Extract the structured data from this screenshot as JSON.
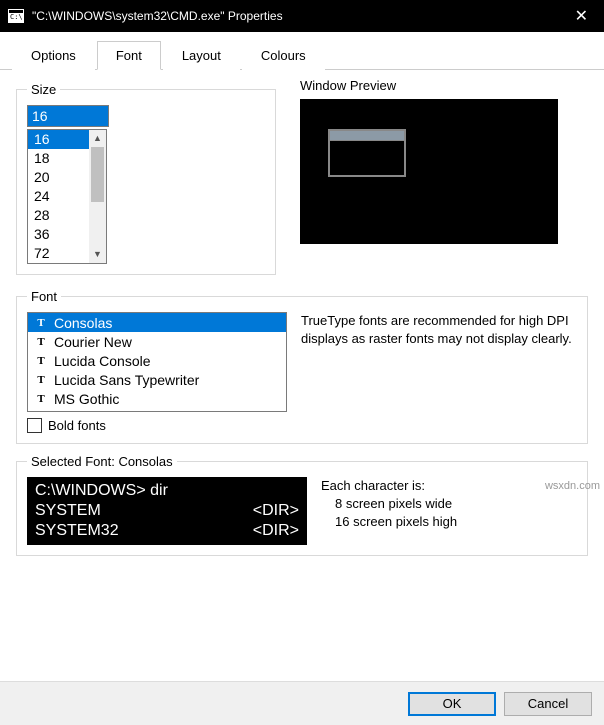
{
  "window": {
    "title": "\"C:\\WINDOWS\\system32\\CMD.exe\" Properties"
  },
  "tabs": {
    "t0": "Options",
    "t1": "Font",
    "t2": "Layout",
    "t3": "Colours"
  },
  "size": {
    "legend": "Size",
    "value": "16",
    "items": {
      "i0": "16",
      "i1": "18",
      "i2": "20",
      "i3": "24",
      "i4": "28",
      "i5": "36",
      "i6": "72"
    }
  },
  "preview": {
    "label": "Window Preview"
  },
  "font": {
    "legend": "Font",
    "items": {
      "i0": "Consolas",
      "i1": "Courier New",
      "i2": "Lucida Console",
      "i3": "Lucida Sans Typewriter",
      "i4": "MS Gothic"
    },
    "hint": "TrueType fonts are recommended for high DPI displays as raster fonts may not display clearly.",
    "bold_label": "Bold fonts"
  },
  "selected": {
    "legend": "Selected Font: Consolas",
    "sample_l1": "C:\\WINDOWS> dir",
    "sample_l2a": "SYSTEM",
    "sample_l2b": "<DIR>",
    "sample_l3a": "SYSTEM32",
    "sample_l3b": "<DIR>",
    "each": "Each character is:",
    "wide": "8 screen pixels wide",
    "high": "16 screen pixels high"
  },
  "buttons": {
    "ok": "OK",
    "cancel": "Cancel"
  },
  "watermark": "wsxdn.com"
}
